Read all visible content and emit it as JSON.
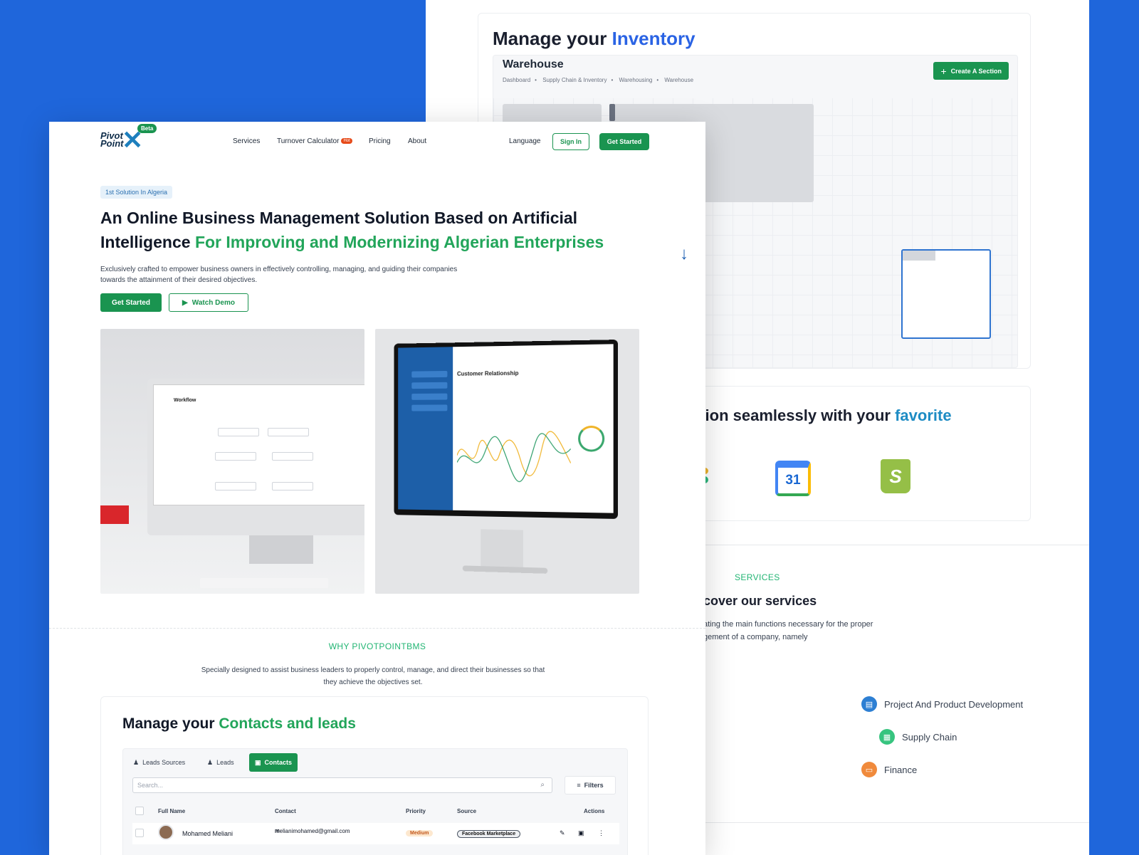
{
  "back": {
    "inventory_title_prefix": "Manage your ",
    "inventory_title_accent": "Inventory",
    "warehouse_title": "Warehouse",
    "breadcrumbs": [
      "Dashboard",
      "Supply Chain & Inventory",
      "Warehousing",
      "Warehouse"
    ],
    "create_section_label": "Create A Section",
    "integration_title_prefix": "ation seamlessly with your ",
    "integration_title_accent": "favorite",
    "calendar_day": "31",
    "shopify_letter": "S",
    "services_kicker": "SERVICES",
    "services_title": "cover our services",
    "services_desc_line1": "ating the main functions necessary for the proper",
    "services_desc_line2": "gement of a company, namely",
    "services": [
      {
        "label": "Project And Product Development",
        "color": "#2d7fd3"
      },
      {
        "label": "Supply Chain",
        "color": "#37c47f"
      },
      {
        "label": "Finance",
        "color": "#f08a3c"
      }
    ]
  },
  "nav": {
    "beta": "Beta",
    "links": [
      "Services",
      "Turnover Calculator",
      "Pricing",
      "About"
    ],
    "hot": "Hot",
    "language": "Language",
    "sign_in": "Sign In",
    "get_started": "Get Started"
  },
  "hero": {
    "badge": "1st Solution In Algeria",
    "title_plain": "An Online Business Management Solution Based on Artificial Intelligence",
    "title_accent": "For Improving and Modernizing Algerian Enterprises",
    "subtitle": "Exclusively crafted to empower business owners in effectively controlling, managing, and guiding their companies towards the attainment of their desired objectives.",
    "get_started": "Get Started",
    "watch_demo": "Watch Demo",
    "workflow_label": "Workflow",
    "crm_label": "Customer Relationship"
  },
  "why": {
    "kicker": "WHY PIVOTPOINTBMS",
    "description": "Specially designed to assist business leaders to properly control, manage, and direct their businesses so that they achieve the objectives set."
  },
  "contacts": {
    "title_prefix": "Manage your ",
    "title_accent": "Contacts and leads",
    "tabs": [
      "Leads Sources",
      "Leads",
      "Contacts"
    ],
    "search_placeholder": "Search...",
    "filters_label": "Filters",
    "columns": [
      "Full Name",
      "Contact",
      "Priority",
      "Source",
      "Actions"
    ],
    "rows": [
      {
        "name": "Mohamed Meliani",
        "email": "melianimohamed@gmail.com",
        "priority": "Medium",
        "source": "Facebook Marketplace"
      }
    ]
  },
  "colors": {
    "brand_green": "#1a9450",
    "accent_blue": "#2a63e4",
    "background_blue": "#1f66db"
  }
}
